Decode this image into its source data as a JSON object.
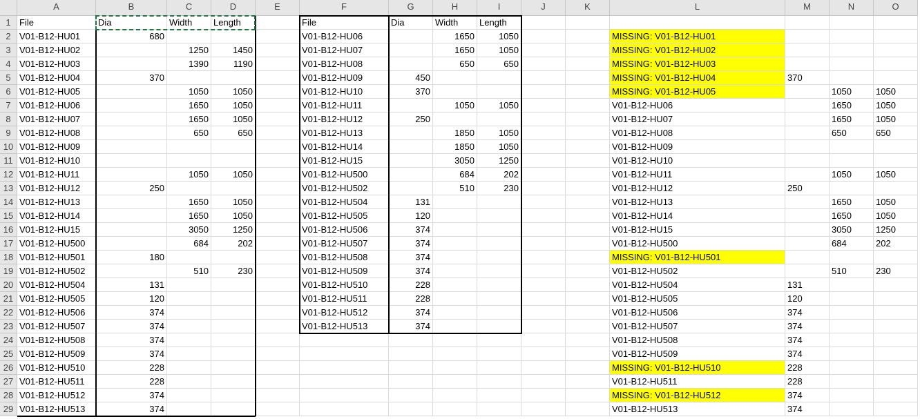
{
  "column_headers": [
    "A",
    "B",
    "C",
    "D",
    "E",
    "F",
    "G",
    "H",
    "I",
    "J",
    "K",
    "L",
    "M",
    "N",
    "O"
  ],
  "row_numbers": [
    "1",
    "2",
    "3",
    "4",
    "5",
    "6",
    "7",
    "8",
    "9",
    "10",
    "11",
    "12",
    "13",
    "14",
    "15",
    "16",
    "17",
    "18",
    "19",
    "20",
    "21",
    "22",
    "23",
    "24",
    "25",
    "26",
    "27",
    "28",
    "29"
  ],
  "highlight_color": "#ffff00",
  "selection_color": "#217346",
  "rows": [
    [
      "File",
      "Dia",
      "Width",
      "Length",
      "",
      "File",
      "Dia",
      "Width",
      "Length",
      "",
      "",
      "",
      "",
      "",
      ""
    ],
    [
      "V01-B12-HU01",
      "680",
      "",
      "",
      "",
      "V01-B12-HU06",
      "",
      "1650",
      "1050",
      "",
      "",
      "MISSING: V01-B12-HU01",
      "",
      "",
      ""
    ],
    [
      "V01-B12-HU02",
      "",
      "1250",
      "1450",
      "",
      "V01-B12-HU07",
      "",
      "1650",
      "1050",
      "",
      "",
      "MISSING: V01-B12-HU02",
      "",
      "",
      ""
    ],
    [
      "V01-B12-HU03",
      "",
      "1390",
      "1190",
      "",
      "V01-B12-HU08",
      "",
      "650",
      "650",
      "",
      "",
      "MISSING: V01-B12-HU03",
      "",
      "",
      ""
    ],
    [
      "V01-B12-HU04",
      "370",
      "",
      "",
      "",
      "V01-B12-HU09",
      "450",
      "",
      "",
      "",
      "",
      "MISSING: V01-B12-HU04",
      "370",
      "",
      ""
    ],
    [
      "V01-B12-HU05",
      "",
      "1050",
      "1050",
      "",
      "V01-B12-HU10",
      "370",
      "",
      "",
      "",
      "",
      "MISSING: V01-B12-HU05",
      "",
      "1050",
      "1050"
    ],
    [
      "V01-B12-HU06",
      "",
      "1650",
      "1050",
      "",
      "V01-B12-HU11",
      "",
      "1050",
      "1050",
      "",
      "",
      "V01-B12-HU06",
      "",
      "1650",
      "1050"
    ],
    [
      "V01-B12-HU07",
      "",
      "1650",
      "1050",
      "",
      "V01-B12-HU12",
      "250",
      "",
      "",
      "",
      "",
      "V01-B12-HU07",
      "",
      "1650",
      "1050"
    ],
    [
      "V01-B12-HU08",
      "",
      "650",
      "650",
      "",
      "V01-B12-HU13",
      "",
      "1850",
      "1050",
      "",
      "",
      "V01-B12-HU08",
      "",
      "650",
      "650"
    ],
    [
      "V01-B12-HU09",
      "",
      "",
      "",
      "",
      "V01-B12-HU14",
      "",
      "1850",
      "1050",
      "",
      "",
      "V01-B12-HU09",
      "",
      "",
      ""
    ],
    [
      "V01-B12-HU10",
      "",
      "",
      "",
      "",
      "V01-B12-HU15",
      "",
      "3050",
      "1250",
      "",
      "",
      "V01-B12-HU10",
      "",
      "",
      ""
    ],
    [
      "V01-B12-HU11",
      "",
      "1050",
      "1050",
      "",
      "V01-B12-HU500",
      "",
      "684",
      "202",
      "",
      "",
      "V01-B12-HU11",
      "",
      "1050",
      "1050"
    ],
    [
      "V01-B12-HU12",
      "250",
      "",
      "",
      "",
      "V01-B12-HU502",
      "",
      "510",
      "230",
      "",
      "",
      "V01-B12-HU12",
      "250",
      "",
      ""
    ],
    [
      "V01-B12-HU13",
      "",
      "1650",
      "1050",
      "",
      "V01-B12-HU504",
      "131",
      "",
      "",
      "",
      "",
      "V01-B12-HU13",
      "",
      "1650",
      "1050"
    ],
    [
      "V01-B12-HU14",
      "",
      "1650",
      "1050",
      "",
      "V01-B12-HU505",
      "120",
      "",
      "",
      "",
      "",
      "V01-B12-HU14",
      "",
      "1650",
      "1050"
    ],
    [
      "V01-B12-HU15",
      "",
      "3050",
      "1250",
      "",
      "V01-B12-HU506",
      "374",
      "",
      "",
      "",
      "",
      "V01-B12-HU15",
      "",
      "3050",
      "1250"
    ],
    [
      "V01-B12-HU500",
      "",
      "684",
      "202",
      "",
      "V01-B12-HU507",
      "374",
      "",
      "",
      "",
      "",
      "V01-B12-HU500",
      "",
      "684",
      "202"
    ],
    [
      "V01-B12-HU501",
      "180",
      "",
      "",
      "",
      "V01-B12-HU508",
      "374",
      "",
      "",
      "",
      "",
      "MISSING: V01-B12-HU501",
      "",
      "",
      ""
    ],
    [
      "V01-B12-HU502",
      "",
      "510",
      "230",
      "",
      "V01-B12-HU509",
      "374",
      "",
      "",
      "",
      "",
      "V01-B12-HU502",
      "",
      "510",
      "230"
    ],
    [
      "V01-B12-HU504",
      "131",
      "",
      "",
      "",
      "V01-B12-HU510",
      "228",
      "",
      "",
      "",
      "",
      "V01-B12-HU504",
      "131",
      "",
      ""
    ],
    [
      "V01-B12-HU505",
      "120",
      "",
      "",
      "",
      "V01-B12-HU511",
      "228",
      "",
      "",
      "",
      "",
      "V01-B12-HU505",
      "120",
      "",
      ""
    ],
    [
      "V01-B12-HU506",
      "374",
      "",
      "",
      "",
      "V01-B12-HU512",
      "374",
      "",
      "",
      "",
      "",
      "V01-B12-HU506",
      "374",
      "",
      ""
    ],
    [
      "V01-B12-HU507",
      "374",
      "",
      "",
      "",
      "V01-B12-HU513",
      "374",
      "",
      "",
      "",
      "",
      "V01-B12-HU507",
      "374",
      "",
      ""
    ],
    [
      "V01-B12-HU508",
      "374",
      "",
      "",
      "",
      "",
      "",
      "",
      "",
      "",
      "",
      "V01-B12-HU508",
      "374",
      "",
      ""
    ],
    [
      "V01-B12-HU509",
      "374",
      "",
      "",
      "",
      "",
      "",
      "",
      "",
      "",
      "",
      "V01-B12-HU509",
      "374",
      "",
      ""
    ],
    [
      "V01-B12-HU510",
      "228",
      "",
      "",
      "",
      "",
      "",
      "",
      "",
      "",
      "",
      "MISSING: V01-B12-HU510",
      "228",
      "",
      ""
    ],
    [
      "V01-B12-HU511",
      "228",
      "",
      "",
      "",
      "",
      "",
      "",
      "",
      "",
      "",
      "V01-B12-HU511",
      "228",
      "",
      ""
    ],
    [
      "V01-B12-HU512",
      "374",
      "",
      "",
      "",
      "",
      "",
      "",
      "",
      "",
      "",
      "MISSING: V01-B12-HU512",
      "374",
      "",
      ""
    ],
    [
      "V01-B12-HU513",
      "374",
      "",
      "",
      "",
      "",
      "",
      "",
      "",
      "",
      "",
      "V01-B12-HU513",
      "374",
      "",
      ""
    ]
  ]
}
